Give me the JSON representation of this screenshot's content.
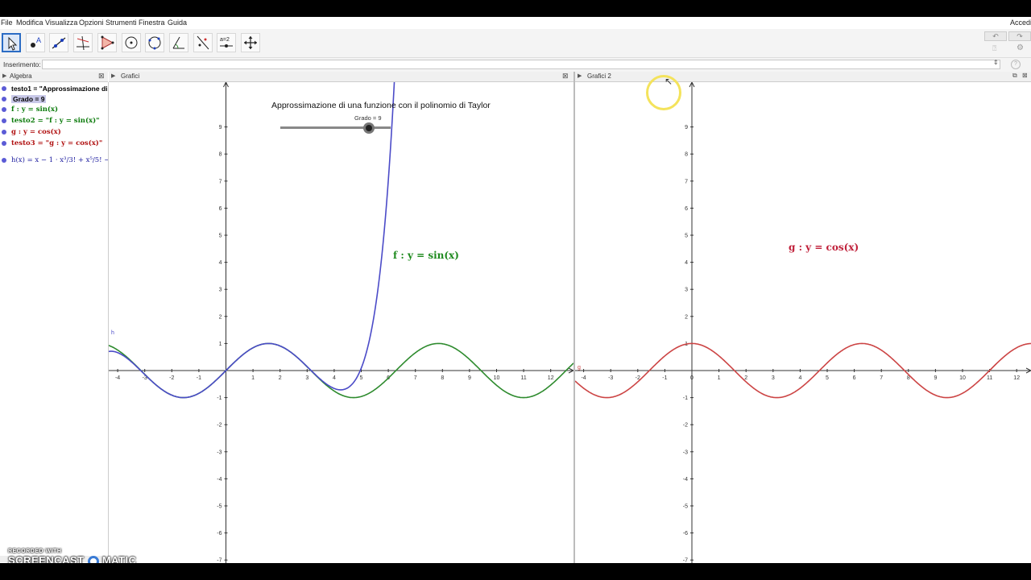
{
  "menubar": {
    "items": [
      "File",
      "Modifica",
      "Visualizza",
      "Opzioni",
      "Strumenti",
      "Finestra",
      "Guida"
    ],
    "right_label": "Accedi"
  },
  "toolbar": {
    "tools": [
      "move-tool",
      "point-tool",
      "line-tool",
      "perpendicular-tool",
      "polygon-tool",
      "circle-tool",
      "conic-tool",
      "angle-tool",
      "reflect-tool",
      "slider-tool",
      "move-view-tool"
    ],
    "slider_tool_label": "a=2",
    "undo_label": "↶",
    "redo_label": "↷"
  },
  "input_bar": {
    "label": "Inserimento:",
    "value": ""
  },
  "algebra": {
    "title": "Algebra",
    "items": [
      {
        "text": "testo1 = \"Approssimazione di u",
        "color": "#000000"
      },
      {
        "text": "Grado = 9",
        "color": "#000000"
      },
      {
        "text": "f : y = sin(x)",
        "color": "#0a7a0a"
      },
      {
        "text": "testo2 = \"f : y = sin(x)\"",
        "color": "#0a7a0a"
      },
      {
        "text": "g : y = cos(x)",
        "color": "#b01010"
      },
      {
        "text": "testo3 = \"g : y = cos(x)\"",
        "color": "#b01010"
      },
      {
        "text": "h(x) = x − 1 · x³/3! + x⁵/5! − 1",
        "color": "#1a1a9e"
      }
    ]
  },
  "graphics1": {
    "title": "Grafici",
    "heading": "Approssimazione di una funzione con il polinomio di Taylor",
    "slider_label": "Grado = 9",
    "slider_value": 9,
    "slider_min": 1,
    "slider_max": 11,
    "f_label": "f : y = sin(x)",
    "h_label": "h",
    "xlim": [
      -4.3,
      12.7
    ],
    "ylim": [
      -7.7,
      9.5
    ],
    "x_ticks": [
      "-4",
      "-3",
      "-2",
      "-1",
      "1",
      "2",
      "3",
      "4",
      "5",
      "6",
      "7",
      "8",
      "9",
      "10",
      "11",
      "12"
    ],
    "y_ticks": [
      "-7",
      "-6",
      "-5",
      "-4",
      "-3",
      "-2",
      "-1",
      "1",
      "2",
      "3",
      "4",
      "5",
      "6",
      "7",
      "8",
      "9"
    ]
  },
  "graphics2": {
    "title": "Grafici 2",
    "g_label": "g : y = cos(x)",
    "g_short": "g",
    "xlim": [
      -4.3,
      12.7
    ],
    "ylim": [
      -7.7,
      9.5
    ],
    "x_ticks": [
      "-4",
      "-3",
      "-2",
      "-1",
      "0",
      "1",
      "2",
      "3",
      "4",
      "5",
      "6",
      "7",
      "8",
      "9",
      "10",
      "11",
      "12"
    ],
    "y_ticks": [
      "-7",
      "-6",
      "-5",
      "-4",
      "-3",
      "-2",
      "-1",
      "1",
      "2",
      "3",
      "4",
      "5",
      "6",
      "7",
      "8",
      "9"
    ]
  },
  "colors": {
    "sin": "#2e8b2e",
    "cos": "#cc4444",
    "taylor": "#4b4bc8",
    "g_label": "#c0203a",
    "f_label": "#1e8a1e"
  },
  "watermark": {
    "line1": "RECORDED WITH",
    "line2": "SCREENCAST",
    "line3": "MATIC"
  }
}
